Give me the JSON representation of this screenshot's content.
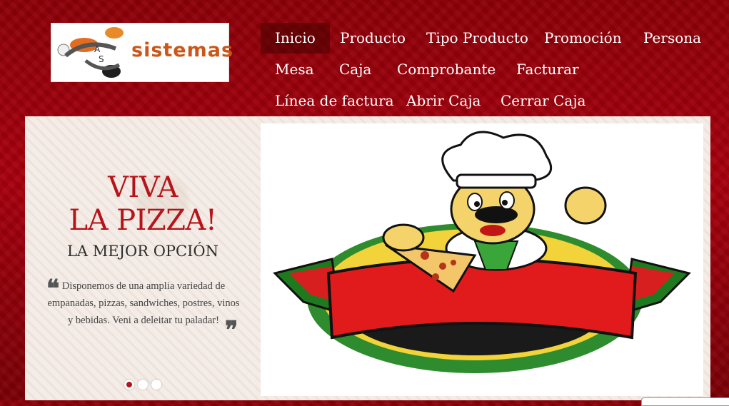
{
  "brand": {
    "logo_text": "sistemas"
  },
  "nav": {
    "row1": [
      "Inicio",
      "Producto",
      "Tipo Producto",
      "Promoción",
      "Persona"
    ],
    "row2": [
      "Mesa",
      "Caja",
      "Comprobante",
      "Facturar"
    ],
    "row3": [
      "Línea de factura",
      "Abrir Caja",
      "Cerrar Caja"
    ],
    "active": "Inicio"
  },
  "hero": {
    "title_line1": "VIVA",
    "title_line2": "LA PIZZA!",
    "subtitle": "LA MEJOR OPCIÓN",
    "quote": "Disponemos de una amplia variedad de empanadas, pizzas, sandwiches, postres, vinos y bebidas. Veni a deleitar tu paladar!",
    "slides_total": 3,
    "slide_active": 1
  },
  "colors": {
    "background": "#9a000b",
    "accent": "#b5141a",
    "panel": "#f4ece6"
  }
}
